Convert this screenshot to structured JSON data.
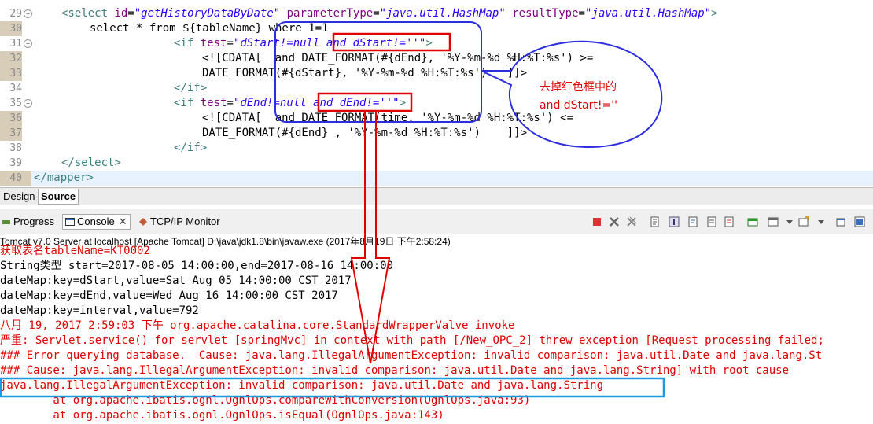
{
  "editor": {
    "lines": [
      {
        "num": "29",
        "fold": "−",
        "text": "<select id=\"getHistoryDataByDate\" parameterType=\"java.util.HashMap\" resultType=\"java.util.HashMap\">"
      },
      {
        "num": "30",
        "fold": "",
        "text": "select * from ${tableName} where 1=1"
      },
      {
        "num": "31",
        "fold": "−",
        "text": "<if test=\"dStart!=null and dStart!=''\">"
      },
      {
        "num": "32",
        "fold": "",
        "text": "<![CDATA[  and DATE_FORMAT(#{dEnd}, '%Y-%m-%d %H:%T:%s') >="
      },
      {
        "num": "33",
        "fold": "",
        "text": "DATE_FORMAT(#{dStart}, '%Y-%m-%d %H:%T:%s')   ]]>"
      },
      {
        "num": "34",
        "fold": "",
        "text": "</if>"
      },
      {
        "num": "35",
        "fold": "−",
        "text": "<if test=\"dEnd!=null and dEnd!=''\">"
      },
      {
        "num": "36",
        "fold": "",
        "text": "<![CDATA[  and DATE_FORMAT(time, '%Y-%m-%d %H:%T:%s') <="
      },
      {
        "num": "37",
        "fold": "",
        "text": "DATE_FORMAT(#{dEnd} , '%Y-%m-%d %H:%T:%s')    ]]>"
      },
      {
        "num": "38",
        "fold": "",
        "text": "</if>"
      },
      {
        "num": "39",
        "fold": "",
        "text": "</select>"
      },
      {
        "num": "40",
        "fold": "",
        "text": "</mapper>"
      }
    ],
    "tabs": {
      "design": "Design",
      "source": "Source"
    }
  },
  "annotation": {
    "line1": "去掉红色框中的",
    "line2": "and dStart!=''"
  },
  "views": {
    "progress": "Progress",
    "console": "Console",
    "tcpip": "TCP/IP Monitor"
  },
  "status": "Tomcat v7.0 Server at localhost [Apache Tomcat] D:\\java\\jdk1.8\\bin\\javaw.exe (2017年8月19日 下午2:58:24)",
  "console": {
    "lines": [
      {
        "text": "获取表名tableName=KT0002",
        "color": "red"
      },
      {
        "text": "String类型 start=2017-08-05 14:00:00,end=2017-08-16 14:00:00",
        "color": "black"
      },
      {
        "text": "dateMap:key=dStart,value=Sat Aug 05 14:00:00 CST 2017",
        "color": "black"
      },
      {
        "text": "dateMap:key=dEnd,value=Wed Aug 16 14:00:00 CST 2017",
        "color": "black"
      },
      {
        "text": "dateMap:key=interval,value=792",
        "color": "black"
      },
      {
        "text": "八月 19, 2017 2:59:03 下午 org.apache.catalina.core.StandardWrapperValve invoke",
        "color": "red"
      },
      {
        "text": "严重: Servlet.service() for servlet [springMvc] in context with path [/New_OPC_2] threw exception [Request processing failed;",
        "color": "red"
      },
      {
        "text": "### Error querying database.  Cause: java.lang.IllegalArgumentException: invalid comparison: java.util.Date and java.lang.St",
        "color": "red"
      },
      {
        "text": "### Cause: java.lang.IllegalArgumentException: invalid comparison: java.util.Date and java.lang.String] with root cause",
        "color": "red"
      },
      {
        "text": "java.lang.IllegalArgumentException: invalid comparison: java.util.Date and java.lang.String",
        "color": "red"
      },
      {
        "text": "        at org.apache.ibatis.ognl.OgnlOps.compareWithConversion(OgnlOps.java:93)",
        "color": "red"
      },
      {
        "text": "        at org.apache.ibatis.ognl.OgnlOps.isEqual(OgnlOps.java:143)",
        "color": "red"
      }
    ]
  },
  "colors": {
    "error": "#e00000",
    "blue_box": "#2c2ce0",
    "cyan_box": "#1a9be0"
  }
}
